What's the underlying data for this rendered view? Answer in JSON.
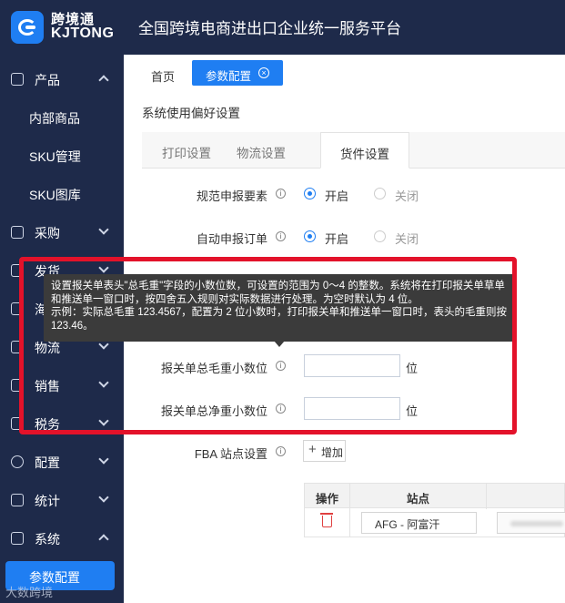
{
  "app": {
    "logo_cn": "跨境通",
    "logo_en": "KJTONG",
    "platform_title": "全国跨境电商进出口企业统一服务平台"
  },
  "sidebar": {
    "items": [
      {
        "label": "产品",
        "icon": "box-icon",
        "expanded": true
      },
      {
        "label": "内部商品"
      },
      {
        "label": "SKU管理"
      },
      {
        "label": "SKU图库"
      },
      {
        "label": "采购",
        "icon": "cart-icon"
      },
      {
        "label": "发货",
        "icon": "truck-icon"
      },
      {
        "label": "海",
        "icon": "globe-icon"
      },
      {
        "label": "物流",
        "icon": "logistics-icon"
      },
      {
        "label": "销售",
        "icon": "chart-icon"
      },
      {
        "label": "税务",
        "icon": "shield-icon"
      },
      {
        "label": "配置",
        "icon": "gear-icon"
      },
      {
        "label": "统计",
        "icon": "cube-icon"
      },
      {
        "label": "系统",
        "icon": "monitor-icon",
        "expanded": true
      },
      {
        "label": "参数配置",
        "active": true
      }
    ],
    "watermark": "大数跨境"
  },
  "tabs": {
    "home": "首页",
    "active": "参数配置"
  },
  "section_title": "系统使用偏好设置",
  "subtabs": [
    "打印设置",
    "物流设置",
    "货件设置"
  ],
  "form": {
    "declare_elements": {
      "label": "规范申报要素",
      "on": "开启",
      "off": "关闭"
    },
    "auto_declare": {
      "label": "自动申报订单",
      "on": "开启",
      "off": "关闭"
    },
    "gross_weight": {
      "label": "报关单总毛重小数位",
      "value": "",
      "unit": "位"
    },
    "net_weight": {
      "label": "报关单总净重小数位",
      "value": "",
      "unit": "位"
    },
    "fba": {
      "label": "FBA 站点设置",
      "add": "增加"
    }
  },
  "tooltip": {
    "line1": "设置报关单表头\"总毛重\"字段的小数位数，可设置的范围为 0～4 的整数。系统将在打印报关单草单和推送单一窗口时，按四舍五入规则对实际数据进行处理。为空时默认为 4 位。",
    "line2": "示例：实际总毛重 123.4567，配置为 2 位小数时，打印报关单和推送单一窗口时，表头的毛重则按 123.46。"
  },
  "table": {
    "headers": [
      "操作",
      "站点"
    ],
    "rows": [
      {
        "site": "AFG - 阿富汗"
      }
    ]
  },
  "colors": {
    "sidebar_bg": "#1e2a4a",
    "primary": "#1f7ef2",
    "highlight": "#e3122a",
    "tooltip_bg": "#3b3b3b"
  }
}
